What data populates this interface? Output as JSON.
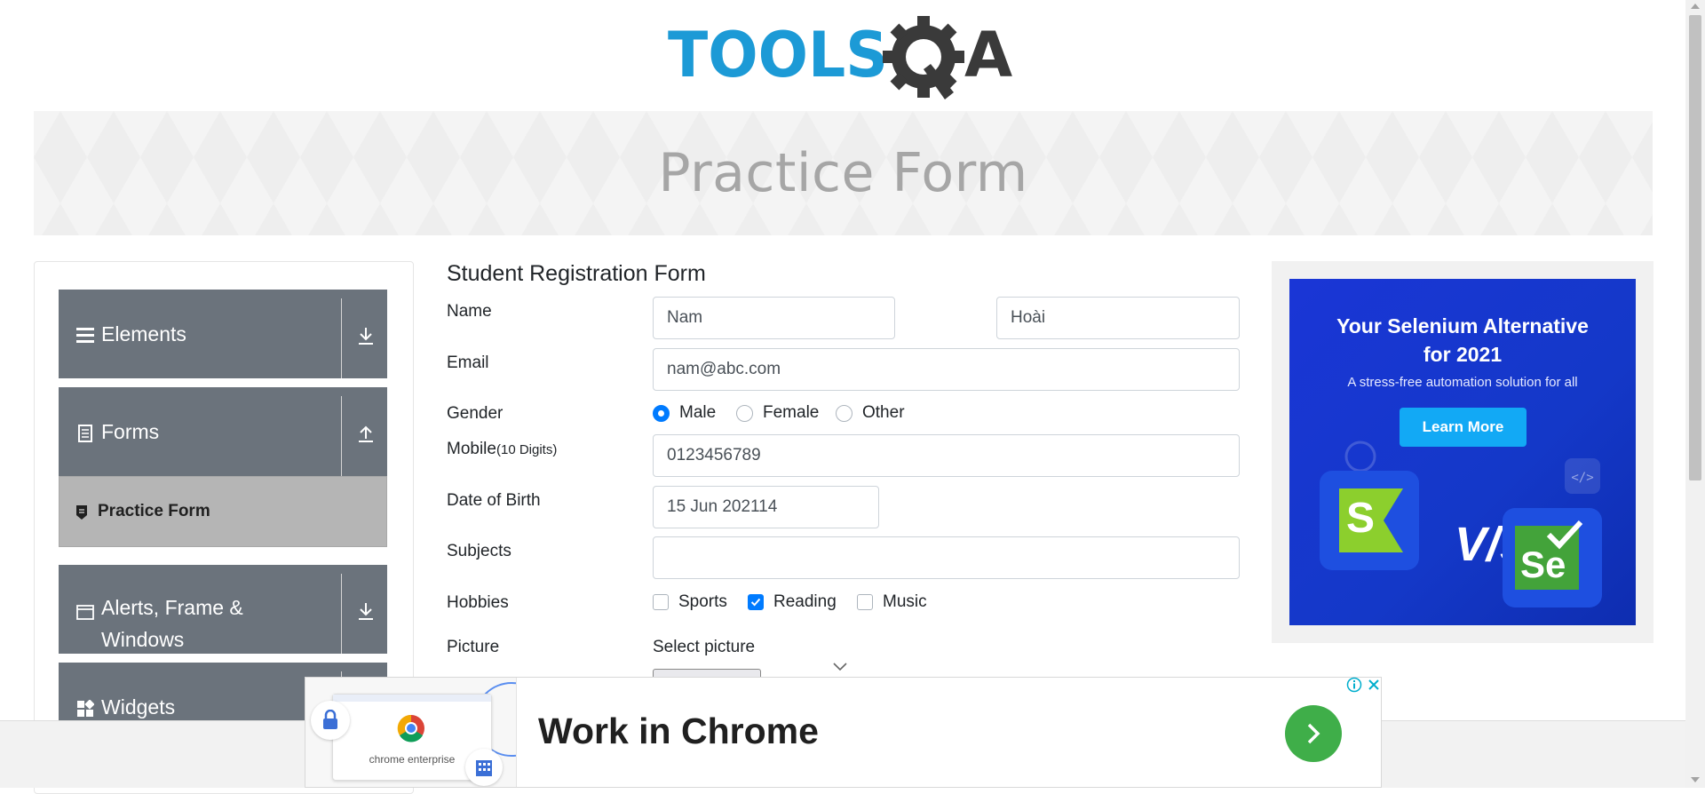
{
  "header": {
    "logo_text_left": "TOOLS",
    "logo_text_right": "A"
  },
  "banner": {
    "title": "Practice Form"
  },
  "sidebar": {
    "groups": [
      {
        "label": "Elements",
        "icon": "hamburger-icon",
        "arrow": "download-arrow-icon"
      },
      {
        "label": "Forms",
        "icon": "document-icon",
        "arrow": "upload-arrow-icon"
      },
      {
        "label_line1": "Alerts, Frame &",
        "label_line2": "Windows",
        "icon": "window-icon",
        "arrow": "download-arrow-icon"
      },
      {
        "label": "Widgets",
        "icon": "widgets-icon"
      }
    ],
    "active_item": {
      "label": "Practice Form",
      "icon": "form-badge-icon"
    }
  },
  "form": {
    "title": "Student Registration Form",
    "labels": {
      "name": "Name",
      "email": "Email",
      "gender": "Gender",
      "mobile": "Mobile",
      "mobile_hint": "(10 Digits)",
      "dob": "Date of Birth",
      "subjects": "Subjects",
      "hobbies": "Hobbies",
      "picture": "Picture"
    },
    "values": {
      "first_name": "Nam",
      "last_name": "Hoài",
      "email": "nam@abc.com",
      "mobile": "0123456789",
      "dob": "15 Jun 202114",
      "subjects": ""
    },
    "gender_options": [
      "Male",
      "Female",
      "Other"
    ],
    "gender_selected": "Male",
    "hobbies": [
      {
        "label": "Sports",
        "checked": false
      },
      {
        "label": "Reading",
        "checked": true
      },
      {
        "label": "Music",
        "checked": false
      }
    ],
    "picture_label": "Select picture"
  },
  "ad_right": {
    "headline_line1": "Your Selenium Alternative",
    "headline_line2": "for 2021",
    "subtitle": "A stress-free automation solution for all",
    "cta": "Learn More",
    "vs": "V/s",
    "logo_left_letter": "S",
    "logo_right_letters": "Se",
    "colors": {
      "bg": "#1438c8",
      "button": "#12a9f5",
      "left_logo_bg": "#8ccf2d",
      "right_logo_bg": "#43a33a"
    }
  },
  "ad_bottom": {
    "thumb_caption": "chrome enterprise",
    "headline": "Work in Chrome",
    "go_color": "#3fae49"
  },
  "colors": {
    "sidebar_group": "#6b737c",
    "sidebar_active": "#b5b5b5",
    "accent": "#007bff",
    "logo_blue": "#1c9ad6",
    "logo_dark": "#3a3a3a"
  }
}
